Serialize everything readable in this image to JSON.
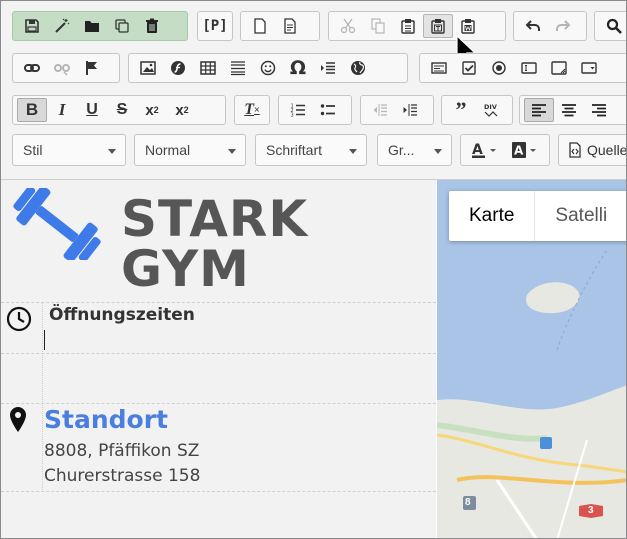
{
  "toolbar": {
    "row1": {
      "group1": [
        "save-icon",
        "magic-wand-icon",
        "folder-icon",
        "copy-icon",
        "trash-icon"
      ],
      "p_label": "[P]",
      "group3": [
        "new-page-icon",
        "page-text-icon"
      ],
      "group4": [
        "cut-icon",
        "copy-icon",
        "paste-icon",
        "paste-text-icon",
        "paste-word-icon"
      ],
      "group5": [
        "undo-icon",
        "redo-icon"
      ],
      "group6": [
        "search-icon"
      ]
    },
    "row2": {
      "icons": [
        "link-icon",
        "unlink-icon",
        "flag-icon",
        "image-icon",
        "flash-icon",
        "table-icon",
        "hr-icon",
        "smiley-icon",
        "omega-icon",
        "pagebreak-icon",
        "globe-icon",
        "form-icon",
        "checkbox-icon",
        "radio-icon",
        "textfield-icon",
        "textarea-icon",
        "select-icon"
      ]
    },
    "row3": {
      "bold": "B",
      "italic": "I",
      "underline": "U",
      "strike": "S",
      "subscript_base": "x",
      "subscript": "2",
      "superscript_base": "x",
      "superscript": "2",
      "clear_format": "T"
    },
    "row4": {
      "style": "Stil",
      "format": "Normal",
      "font": "Schriftart",
      "size": "Gr...",
      "source": "Quelle"
    }
  },
  "content": {
    "logo_text": "STARK GYM",
    "hours_heading": "Öffnungszeiten",
    "location_heading": "Standort",
    "address_line1": "8808, Pfäffikon SZ",
    "address_line2": "Churerstrasse 158"
  },
  "map": {
    "tab_map": "Karte",
    "tab_satellite": "Satelli",
    "badge1": "8",
    "badge2": "3"
  },
  "colors": {
    "accent_blue": "#4a7fe0",
    "logo_blue": "#3f7be8",
    "logo_grey": "#565656"
  }
}
